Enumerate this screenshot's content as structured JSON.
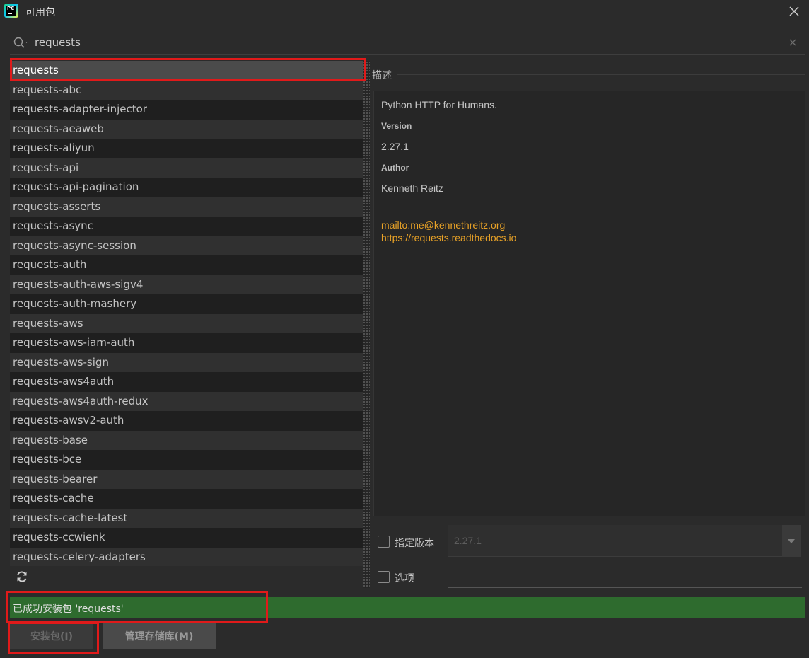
{
  "window": {
    "title": "可用包",
    "logo_text": "PC"
  },
  "search": {
    "query": "requests"
  },
  "packages": [
    "requests",
    "requests-abc",
    "requests-adapter-injector",
    "requests-aeaweb",
    "requests-aliyun",
    "requests-api",
    "requests-api-pagination",
    "requests-asserts",
    "requests-async",
    "requests-async-session",
    "requests-auth",
    "requests-auth-aws-sigv4",
    "requests-auth-mashery",
    "requests-aws",
    "requests-aws-iam-auth",
    "requests-aws-sign",
    "requests-aws4auth",
    "requests-aws4auth-redux",
    "requests-awsv2-auth",
    "requests-base",
    "requests-bce",
    "requests-bearer",
    "requests-cache",
    "requests-cache-latest",
    "requests-ccwienk",
    "requests-celery-adapters"
  ],
  "selected_package": "requests",
  "description": {
    "header": "描述",
    "summary": "Python HTTP for Humans.",
    "version_label": "Version",
    "version_value": "2.27.1",
    "author_label": "Author",
    "author_value": "Kenneth Reitz",
    "links": [
      "mailto:me@kennethreitz.org",
      "https://requests.readthedocs.io"
    ]
  },
  "options": {
    "specify_version_label": "指定版本",
    "specify_version_checked": false,
    "version_value": "2.27.1",
    "options_label": "选项",
    "options_checked": false
  },
  "status": {
    "message": "已成功安装包 'requests'"
  },
  "buttons": {
    "install": "安装包(I)",
    "manage_repos": "管理存储库(M)"
  },
  "colors": {
    "background": "#2b2b2b",
    "status_success": "#2e6b2e",
    "link": "#e8a227",
    "highlight": "#e01a1a"
  }
}
